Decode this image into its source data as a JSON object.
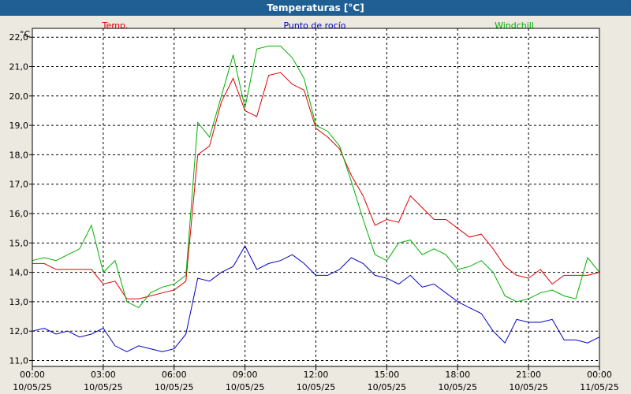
{
  "window": {
    "title": "Temperaturas [°C]"
  },
  "chart_data": {
    "type": "line",
    "title": "Temperaturas [°C]",
    "ylabel": "°C",
    "xlabel": "",
    "ylim": [
      10.8,
      22.3
    ],
    "xlim": [
      0,
      24
    ],
    "grid": true,
    "legend_position": "top",
    "y_ticks": [
      "22,0",
      "21,0",
      "20,0",
      "19,0",
      "18,0",
      "17,0",
      "16,0",
      "15,0",
      "14,0",
      "13,0",
      "12,0",
      "11,0"
    ],
    "x_ticks": [
      {
        "time": "00:00",
        "date": "10/05/25"
      },
      {
        "time": "03:00",
        "date": "10/05/25"
      },
      {
        "time": "06:00",
        "date": "10/05/25"
      },
      {
        "time": "09:00",
        "date": "10/05/25"
      },
      {
        "time": "12:00",
        "date": "10/05/25"
      },
      {
        "time": "15:00",
        "date": "10/05/25"
      },
      {
        "time": "18:00",
        "date": "10/05/25"
      },
      {
        "time": "21:00",
        "date": "10/05/25"
      },
      {
        "time": "00:00",
        "date": "11/05/25"
      }
    ],
    "x": [
      0,
      0.5,
      1,
      1.5,
      2,
      2.5,
      3,
      3.5,
      4,
      4.5,
      5,
      5.5,
      6,
      6.5,
      7,
      7.5,
      8,
      8.5,
      9,
      9.5,
      10,
      10.5,
      11,
      11.5,
      12,
      12.5,
      13,
      13.5,
      14,
      14.5,
      15,
      15.5,
      16,
      16.5,
      17,
      17.5,
      18,
      18.5,
      19,
      19.5,
      20,
      20.5,
      21,
      21.5,
      22,
      22.5,
      23,
      23.5,
      24
    ],
    "series": [
      {
        "name": "Temp.",
        "color": "#e00000",
        "values": [
          14.3,
          14.3,
          14.1,
          14.1,
          14.1,
          14.1,
          13.6,
          13.7,
          13.1,
          13.1,
          13.2,
          13.3,
          13.4,
          13.7,
          18.0,
          18.3,
          19.8,
          20.6,
          19.5,
          19.3,
          20.7,
          20.8,
          20.4,
          20.2,
          18.9,
          18.6,
          18.2,
          17.3,
          16.6,
          15.6,
          15.8,
          15.7,
          16.6,
          16.2,
          15.8,
          15.8,
          15.5,
          15.2,
          15.3,
          14.8,
          14.2,
          13.9,
          13.8,
          14.1,
          13.6,
          13.9,
          13.9,
          13.9,
          14.0
        ]
      },
      {
        "name": "Punto de rocío",
        "color": "#0000c0",
        "values": [
          12.0,
          12.1,
          11.9,
          12.0,
          11.8,
          11.9,
          12.1,
          11.5,
          11.3,
          11.5,
          11.4,
          11.3,
          11.4,
          11.9,
          13.8,
          13.7,
          14.0,
          14.2,
          14.9,
          14.1,
          14.3,
          14.4,
          14.6,
          14.3,
          13.9,
          13.9,
          14.1,
          14.5,
          14.3,
          13.9,
          13.8,
          13.6,
          13.9,
          13.5,
          13.6,
          13.3,
          13.0,
          12.8,
          12.6,
          12.0,
          11.6,
          12.4,
          12.3,
          12.3,
          12.4,
          11.7,
          11.7,
          11.6,
          11.8
        ]
      },
      {
        "name": "Windchill",
        "color": "#00b000",
        "values": [
          14.4,
          14.5,
          14.4,
          14.6,
          14.8,
          15.6,
          14.0,
          14.4,
          13.0,
          12.8,
          13.3,
          13.5,
          13.6,
          13.9,
          19.1,
          18.6,
          20.0,
          21.4,
          19.6,
          21.6,
          21.7,
          21.7,
          21.3,
          20.6,
          19.0,
          18.8,
          18.3,
          17.1,
          15.8,
          14.6,
          14.4,
          15.0,
          15.1,
          14.6,
          14.8,
          14.6,
          14.1,
          14.2,
          14.4,
          14.0,
          13.2,
          13.0,
          13.1,
          13.3,
          13.4,
          13.2,
          13.1,
          14.5,
          14.0
        ]
      }
    ]
  }
}
